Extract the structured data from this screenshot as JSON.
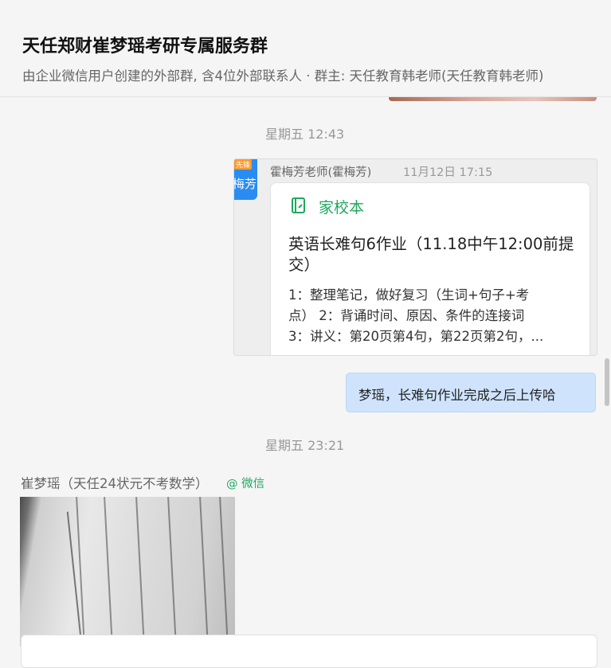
{
  "header": {
    "title": "天任郑财崔梦瑶考研专属服务群",
    "subtitle": "由企业微信用户创建的外部群, 含4位外部联系人 · 群主: 天任教育韩老师(天任教育韩老师)"
  },
  "messages": {
    "time_1": "星期五 12:43",
    "forward": {
      "avatar_text": "梅芳",
      "avatar_badge": "先锋",
      "sender": "霍梅芳老师(霍梅芳)",
      "time": "11月12日 17:15",
      "app_icon": "notebook-icon",
      "app_name": "家校本",
      "card_title": "英语长难句6作业（11.18中午12:00前提交）",
      "line_1": "1：整理笔记，做好复习（生词+句子+考",
      "line_2": "点） 2：背诵时间、原因、条件的连接词",
      "line_3": "3：讲义：第20页第4句，第22页第2句，..."
    },
    "own_bubble": "梦瑶，长难句作业完成之后上传哈",
    "time_2": "星期五 23:21",
    "sender_name": "崔梦瑶（天任24状元不考数学）",
    "sender_source": "@ 微信"
  },
  "colors": {
    "accent_green": "#1fa85f",
    "bubble_blue": "#cfe4fc",
    "avatar_blue": "#2a8cf0"
  }
}
